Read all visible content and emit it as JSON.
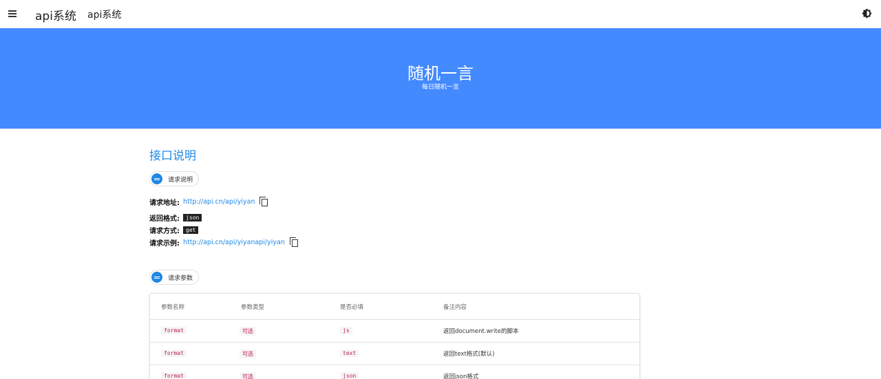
{
  "appbar": {
    "brand": "api系统",
    "subtitle": "api系统"
  },
  "hero": {
    "title": "随机一言",
    "subtitle": "每日随机一言"
  },
  "section": {
    "title": "接口说明",
    "request_chip": "请求说明",
    "params_chip": "请求参数"
  },
  "info": {
    "url_label": "请求地址:",
    "url_value": "http://api.cn/api/yiyan",
    "format_label": "返回格式:",
    "format_value": "json",
    "method_label": "请求方式:",
    "method_value": "get",
    "example_label": "请求示例:",
    "example_value": "http://api.cn/api/yiyanapi/yiyan"
  },
  "table": {
    "headers": [
      "参数名称",
      "参数类型",
      "是否必填",
      "备注内容"
    ],
    "rows": [
      {
        "name": "format",
        "type": "可选",
        "value": "js",
        "note": "返回document.write的脚本"
      },
      {
        "name": "format",
        "type": "可选",
        "value": "text",
        "note": "返回text格式(默认)"
      },
      {
        "name": "format",
        "type": "可选",
        "value": "json",
        "note": "返回json格式"
      }
    ]
  },
  "colors": {
    "accent": "#448aff",
    "link": "#1e88e5",
    "code": "#c2185b"
  }
}
